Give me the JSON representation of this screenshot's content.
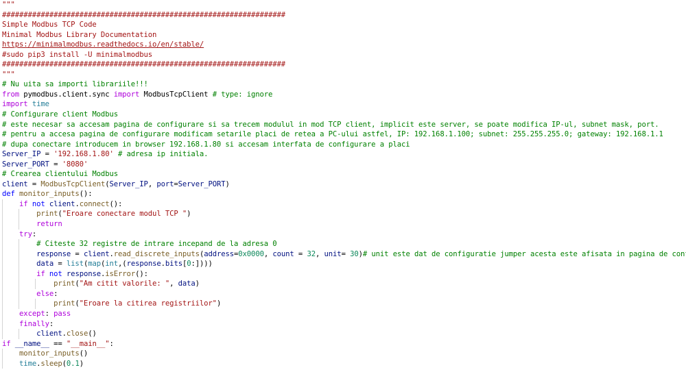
{
  "editor": {
    "colors": {
      "str": "#a31515",
      "cmt": "#008000",
      "kw": "#0000ff",
      "kw2": "#af00db",
      "fn": "#795e26",
      "var": "#001080",
      "cls": "#267f99",
      "num": "#098658",
      "plain": "#000000",
      "link": "#a31515"
    },
    "lines": [
      {
        "indent": 0,
        "tokens": [
          {
            "t": "\"\"\"",
            "c": "str"
          }
        ]
      },
      {
        "indent": 0,
        "tokens": [
          {
            "t": "##################################################################",
            "c": "str"
          }
        ]
      },
      {
        "indent": 0,
        "tokens": [
          {
            "t": "Simple Modbus TCP Code",
            "c": "str"
          }
        ]
      },
      {
        "indent": 0,
        "tokens": [
          {
            "t": "Minimal Modbus Library Documentation",
            "c": "str"
          }
        ]
      },
      {
        "indent": 0,
        "tokens": [
          {
            "t": "https://minimalmodbus.readthedocs.io/en/stable/",
            "c": "link"
          }
        ]
      },
      {
        "indent": 0,
        "tokens": [
          {
            "t": "#sudo pip3 install -U minimalmodbus",
            "c": "str"
          }
        ]
      },
      {
        "indent": 0,
        "tokens": [
          {
            "t": "##################################################################",
            "c": "str"
          }
        ]
      },
      {
        "indent": 0,
        "tokens": [
          {
            "t": "\"\"\"",
            "c": "str"
          }
        ]
      },
      {
        "indent": 0,
        "tokens": [
          {
            "t": "# Nu uita sa importi librariile!!!",
            "c": "cmt"
          }
        ]
      },
      {
        "indent": 0,
        "tokens": [
          {
            "t": "from",
            "c": "kw2"
          },
          {
            "t": " pymodbus.client.sync ",
            "c": "plain"
          },
          {
            "t": "import",
            "c": "kw2"
          },
          {
            "t": " ModbusTcpClient ",
            "c": "plain"
          },
          {
            "t": "# type: ignore",
            "c": "cmt"
          }
        ]
      },
      {
        "indent": 0,
        "tokens": [
          {
            "t": "import",
            "c": "kw2"
          },
          {
            "t": " time",
            "c": "cls"
          }
        ]
      },
      {
        "indent": 0,
        "tokens": [
          {
            "t": "# Configurare client Modbus",
            "c": "cmt"
          }
        ]
      },
      {
        "indent": 0,
        "tokens": [
          {
            "t": "# este necesar sa accesam pagina de configurare si sa trecem modulul in mod TCP client, implicit este server, se poate modifica IP-ul, subnet mask, port.",
            "c": "cmt"
          }
        ]
      },
      {
        "indent": 0,
        "tokens": [
          {
            "t": "# pentru a accesa pagina de configurare modificam setarile placi de retea a PC-ului astfel, IP: 192.168.1.100; subnet: 255.255.255.0; gateway: 192.168.1.1",
            "c": "cmt"
          }
        ]
      },
      {
        "indent": 0,
        "tokens": [
          {
            "t": "# dupa conectare introducem in browser 192.168.1.80 si accesam interfata de configurare a placi",
            "c": "cmt"
          }
        ]
      },
      {
        "indent": 0,
        "tokens": [
          {
            "t": "Server_IP",
            "c": "var"
          },
          {
            "t": " = ",
            "c": "plain"
          },
          {
            "t": "'192.168.1.80'",
            "c": "str"
          },
          {
            "t": " ",
            "c": "plain"
          },
          {
            "t": "# adresa ip initiala.",
            "c": "cmt"
          }
        ]
      },
      {
        "indent": 0,
        "tokens": [
          {
            "t": "Server_PORT",
            "c": "var"
          },
          {
            "t": " = ",
            "c": "plain"
          },
          {
            "t": "'8080'",
            "c": "str"
          }
        ]
      },
      {
        "indent": 0,
        "tokens": [
          {
            "t": "# Crearea clientului Modbus",
            "c": "cmt"
          }
        ]
      },
      {
        "indent": 0,
        "tokens": [
          {
            "t": "client",
            "c": "var"
          },
          {
            "t": " = ",
            "c": "plain"
          },
          {
            "t": "ModbusTcpClient",
            "c": "fn"
          },
          {
            "t": "(",
            "c": "plain"
          },
          {
            "t": "Server_IP",
            "c": "var"
          },
          {
            "t": ", ",
            "c": "plain"
          },
          {
            "t": "port",
            "c": "var"
          },
          {
            "t": "=",
            "c": "plain"
          },
          {
            "t": "Server_PORT",
            "c": "var"
          },
          {
            "t": ")",
            "c": "plain"
          }
        ]
      },
      {
        "indent": 0,
        "tokens": [
          {
            "t": "def",
            "c": "kw"
          },
          {
            "t": " ",
            "c": "plain"
          },
          {
            "t": "monitor_inputs",
            "c": "fn"
          },
          {
            "t": "():",
            "c": "plain"
          }
        ]
      },
      {
        "indent": 1,
        "tokens": [
          {
            "t": "if",
            "c": "kw2"
          },
          {
            "t": " ",
            "c": "plain"
          },
          {
            "t": "not",
            "c": "kw"
          },
          {
            "t": " ",
            "c": "plain"
          },
          {
            "t": "client",
            "c": "var"
          },
          {
            "t": ".",
            "c": "plain"
          },
          {
            "t": "connect",
            "c": "fn"
          },
          {
            "t": "():",
            "c": "plain"
          }
        ]
      },
      {
        "indent": 2,
        "tokens": [
          {
            "t": "print",
            "c": "fn"
          },
          {
            "t": "(",
            "c": "plain"
          },
          {
            "t": "\"Eroare conectare modul TCP \"",
            "c": "str"
          },
          {
            "t": ")",
            "c": "plain"
          }
        ]
      },
      {
        "indent": 2,
        "tokens": [
          {
            "t": "return",
            "c": "kw2"
          }
        ]
      },
      {
        "indent": 1,
        "tokens": [
          {
            "t": "try",
            "c": "kw2"
          },
          {
            "t": ":",
            "c": "plain"
          }
        ]
      },
      {
        "indent": 2,
        "tokens": [
          {
            "t": "# Citeste 32 registre de intrare incepand de la adresa 0",
            "c": "cmt"
          }
        ]
      },
      {
        "indent": 2,
        "tokens": [
          {
            "t": "response",
            "c": "var"
          },
          {
            "t": " = ",
            "c": "plain"
          },
          {
            "t": "client",
            "c": "var"
          },
          {
            "t": ".",
            "c": "plain"
          },
          {
            "t": "read_discrete_inputs",
            "c": "fn"
          },
          {
            "t": "(",
            "c": "plain"
          },
          {
            "t": "address",
            "c": "var"
          },
          {
            "t": "=",
            "c": "plain"
          },
          {
            "t": "0x0000",
            "c": "num"
          },
          {
            "t": ", ",
            "c": "plain"
          },
          {
            "t": "count",
            "c": "var"
          },
          {
            "t": " = ",
            "c": "plain"
          },
          {
            "t": "32",
            "c": "num"
          },
          {
            "t": ", ",
            "c": "plain"
          },
          {
            "t": "unit",
            "c": "var"
          },
          {
            "t": "= ",
            "c": "plain"
          },
          {
            "t": "30",
            "c": "num"
          },
          {
            "t": ")",
            "c": "plain"
          },
          {
            "t": "# unit este dat de configuratie jumper acesta este afisata in pagina de configurare",
            "c": "cmt"
          }
        ]
      },
      {
        "indent": 2,
        "tokens": [
          {
            "t": "data",
            "c": "var"
          },
          {
            "t": " = ",
            "c": "plain"
          },
          {
            "t": "list",
            "c": "cls"
          },
          {
            "t": "(",
            "c": "plain"
          },
          {
            "t": "map",
            "c": "cls"
          },
          {
            "t": "(",
            "c": "plain"
          },
          {
            "t": "int",
            "c": "cls"
          },
          {
            "t": ",(",
            "c": "plain"
          },
          {
            "t": "response",
            "c": "var"
          },
          {
            "t": ".",
            "c": "plain"
          },
          {
            "t": "bits",
            "c": "var"
          },
          {
            "t": "[",
            "c": "plain"
          },
          {
            "t": "0",
            "c": "num"
          },
          {
            "t": ":])))",
            "c": "plain"
          }
        ]
      },
      {
        "indent": 2,
        "tokens": [
          {
            "t": "if",
            "c": "kw2"
          },
          {
            "t": " ",
            "c": "plain"
          },
          {
            "t": "not",
            "c": "kw"
          },
          {
            "t": " ",
            "c": "plain"
          },
          {
            "t": "response",
            "c": "var"
          },
          {
            "t": ".",
            "c": "plain"
          },
          {
            "t": "isError",
            "c": "fn"
          },
          {
            "t": "():",
            "c": "plain"
          }
        ]
      },
      {
        "indent": 3,
        "tokens": [
          {
            "t": "print",
            "c": "fn"
          },
          {
            "t": "(",
            "c": "plain"
          },
          {
            "t": "\"Am citit valorile: \"",
            "c": "str"
          },
          {
            "t": ", ",
            "c": "plain"
          },
          {
            "t": "data",
            "c": "var"
          },
          {
            "t": ")",
            "c": "plain"
          }
        ]
      },
      {
        "indent": 2,
        "tokens": [
          {
            "t": "else",
            "c": "kw2"
          },
          {
            "t": ":",
            "c": "plain"
          }
        ]
      },
      {
        "indent": 3,
        "tokens": [
          {
            "t": "print",
            "c": "fn"
          },
          {
            "t": "(",
            "c": "plain"
          },
          {
            "t": "\"Eroare la citirea registriilor\"",
            "c": "str"
          },
          {
            "t": ")",
            "c": "plain"
          }
        ]
      },
      {
        "indent": 1,
        "tokens": [
          {
            "t": "except",
            "c": "kw2"
          },
          {
            "t": ": ",
            "c": "plain"
          },
          {
            "t": "pass",
            "c": "kw2"
          }
        ]
      },
      {
        "indent": 1,
        "tokens": [
          {
            "t": "finally",
            "c": "kw2"
          },
          {
            "t": ":",
            "c": "plain"
          }
        ]
      },
      {
        "indent": 2,
        "tokens": [
          {
            "t": "client",
            "c": "var"
          },
          {
            "t": ".",
            "c": "plain"
          },
          {
            "t": "close",
            "c": "fn"
          },
          {
            "t": "()",
            "c": "plain"
          }
        ]
      },
      {
        "indent": 0,
        "tokens": [
          {
            "t": "if",
            "c": "kw2"
          },
          {
            "t": " ",
            "c": "plain"
          },
          {
            "t": "__name__",
            "c": "var"
          },
          {
            "t": " == ",
            "c": "plain"
          },
          {
            "t": "\"__main__\"",
            "c": "str"
          },
          {
            "t": ":",
            "c": "plain"
          }
        ]
      },
      {
        "indent": 1,
        "tokens": [
          {
            "t": "monitor_inputs",
            "c": "fn"
          },
          {
            "t": "()",
            "c": "plain"
          }
        ]
      },
      {
        "indent": 1,
        "tokens": [
          {
            "t": "time",
            "c": "cls"
          },
          {
            "t": ".",
            "c": "plain"
          },
          {
            "t": "sleep",
            "c": "fn"
          },
          {
            "t": "(",
            "c": "plain"
          },
          {
            "t": "0.1",
            "c": "num"
          },
          {
            "t": ")",
            "c": "plain"
          }
        ]
      }
    ]
  }
}
